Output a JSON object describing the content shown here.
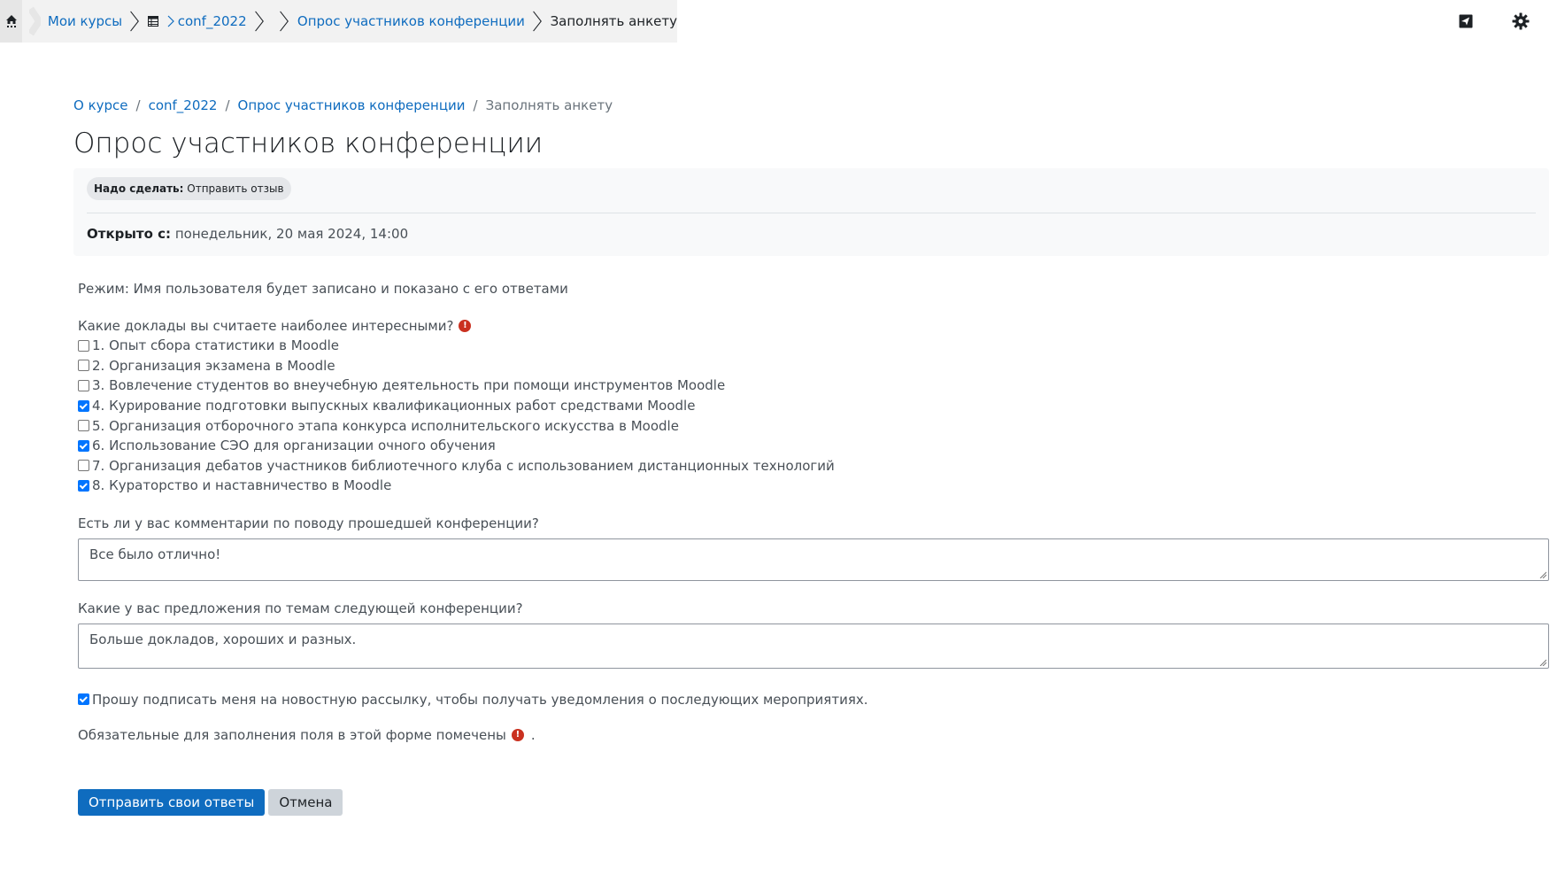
{
  "topnav": {
    "crumbs": [
      "Мои курсы",
      "conf_2022",
      "Опрос участников конференции",
      "Заполнять анкету"
    ]
  },
  "pathbar": [
    "О курсе",
    "conf_2022",
    "Опрос участников конференции",
    "Заполнять анкету"
  ],
  "page_title": "Опрос участников конференции",
  "todo": {
    "label": "Надо сделать:",
    "value": "Отправить отзыв"
  },
  "opened": {
    "label": "Открыто с:",
    "value": "понедельник, 20 мая 2024, 14:00"
  },
  "mode_text": "Режим: Имя пользователя будет записано и показано с его ответами",
  "q1": {
    "label": "Какие доклады вы считаете наиболее интересными?",
    "options": [
      {
        "text": "1. Опыт сбора статистики в Moodle",
        "checked": false
      },
      {
        "text": "2. Организация экзамена в Moodle",
        "checked": false
      },
      {
        "text": "3. Вовлечение студентов во внеучебную деятельность при помощи инструментов Moodle",
        "checked": false
      },
      {
        "text": "4. Курирование подготовки выпускных квалификационных работ средствами Moodle",
        "checked": true
      },
      {
        "text": "5. Организация отборочного этапа конкурса исполнительского искусства в Moodle",
        "checked": false
      },
      {
        "text": "6. Использование СЭО для организации очного обучения",
        "checked": true
      },
      {
        "text": "7. Организация дебатов участников библиотечного клуба с использованием дистанционных технологий",
        "checked": false
      },
      {
        "text": "8. Кураторство и наставничество в Moodle",
        "checked": true
      }
    ]
  },
  "q2": {
    "label": "Есть ли у вас комментарии по поводу прошедшей конференции?",
    "value": "Все было отлично!"
  },
  "q3": {
    "label": "Какие у вас предложения по темам следующей конференции?",
    "value": "Больше докладов, хороших и разных."
  },
  "subscribe": {
    "text": "Прошу подписать меня на новостную рассылку, чтобы получать уведомления о последующих мероприятиях.",
    "checked": true
  },
  "required_note": {
    "text": "Обязательные для заполнения поля в этой форме помечены",
    "suffix": "."
  },
  "buttons": {
    "submit": "Отправить свои ответы",
    "cancel": "Отмена"
  },
  "colors": {
    "link": "#0f6cbf",
    "primary": "#0f6cbf",
    "danger": "#ca3120",
    "muted_bg": "#f8f9fa"
  }
}
